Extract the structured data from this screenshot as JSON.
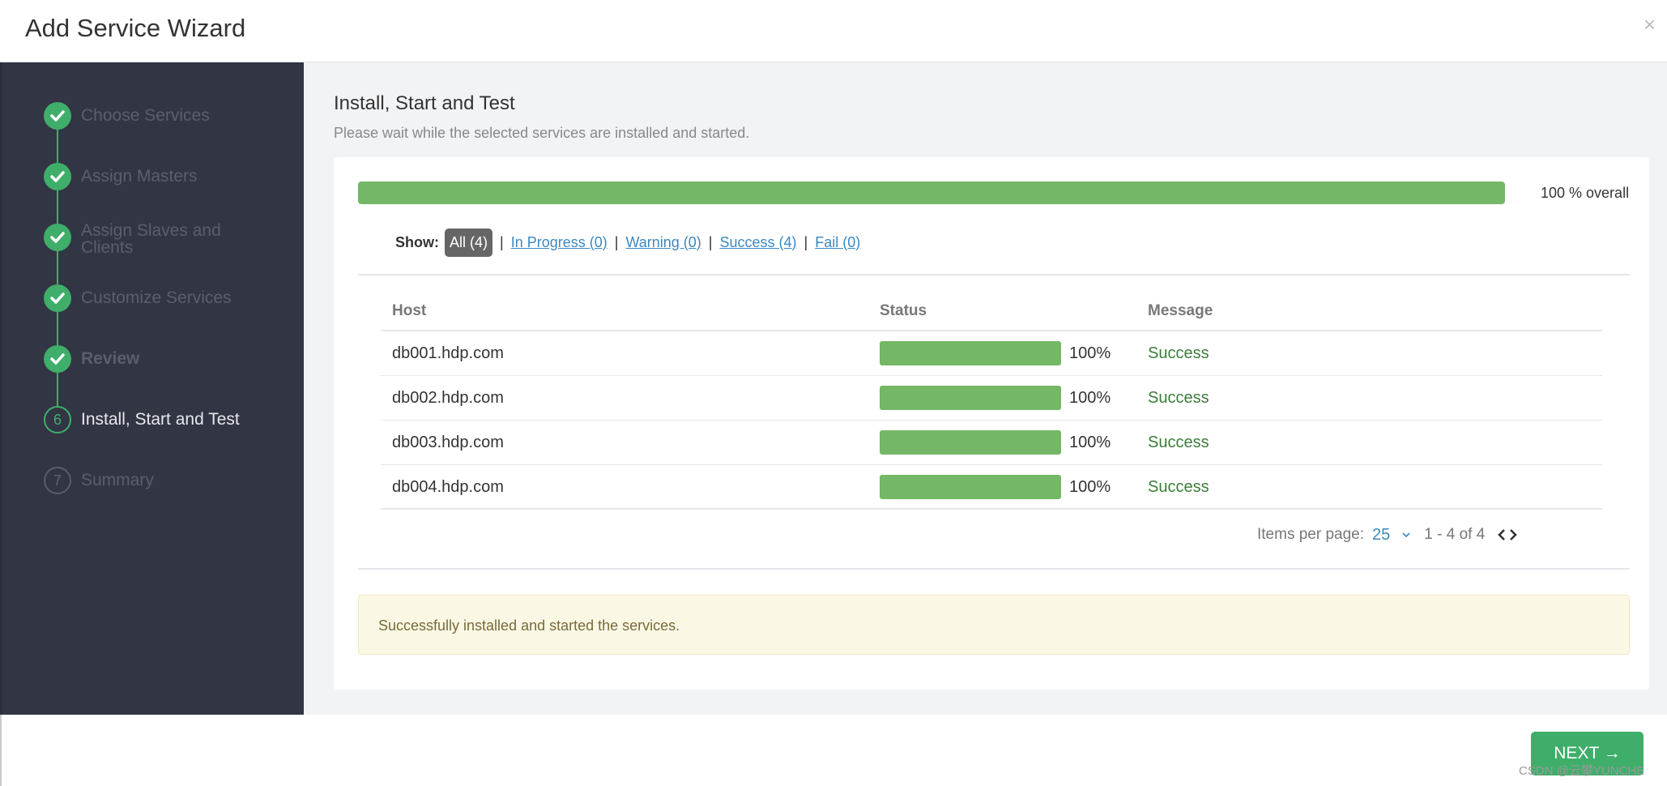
{
  "header": {
    "title": "Add Service Wizard",
    "close_glyph": "×"
  },
  "sidebar": {
    "steps": [
      {
        "label": "Choose Services",
        "state": "done"
      },
      {
        "label": "Assign Masters",
        "state": "done"
      },
      {
        "label": "Assign Slaves and Clients",
        "state": "done"
      },
      {
        "label": "Customize Services",
        "state": "done"
      },
      {
        "label": "Review",
        "state": "done"
      },
      {
        "label": "Install, Start and Test",
        "state": "current",
        "number": "6"
      },
      {
        "label": "Summary",
        "state": "future",
        "number": "7"
      }
    ]
  },
  "main": {
    "heading": "Install, Start and Test",
    "subheading": "Please wait while the selected services are installed and started.",
    "overall_progress": 100,
    "overall_text": "100 % overall",
    "filter": {
      "show_label": "Show:",
      "all": "All (4)",
      "in_progress": "In Progress (0)",
      "warning": "Warning (0)",
      "success": "Success (4)",
      "fail": "Fail (0)",
      "separator": "|"
    },
    "table": {
      "headers": {
        "host": "Host",
        "status": "Status",
        "message": "Message"
      },
      "rows": [
        {
          "host": "db001.hdp.com",
          "progress": 100,
          "percent": "100%",
          "message": "Success"
        },
        {
          "host": "db002.hdp.com",
          "progress": 100,
          "percent": "100%",
          "message": "Success"
        },
        {
          "host": "db003.hdp.com",
          "progress": 100,
          "percent": "100%",
          "message": "Success"
        },
        {
          "host": "db004.hdp.com",
          "progress": 100,
          "percent": "100%",
          "message": "Success"
        }
      ]
    },
    "pager": {
      "items_label": "Items per page:",
      "per_page": "25",
      "range": "1 - 4 of 4"
    },
    "alert": "Successfully installed and started the services."
  },
  "footer": {
    "next_label": "NEXT →",
    "watermark": "CSDN @云攀YUNCHE"
  },
  "colors": {
    "accent_green": "#3fae6a",
    "progress_green": "#74b766",
    "link_blue": "#3b88c2",
    "sidebar_bg": "#323544"
  }
}
